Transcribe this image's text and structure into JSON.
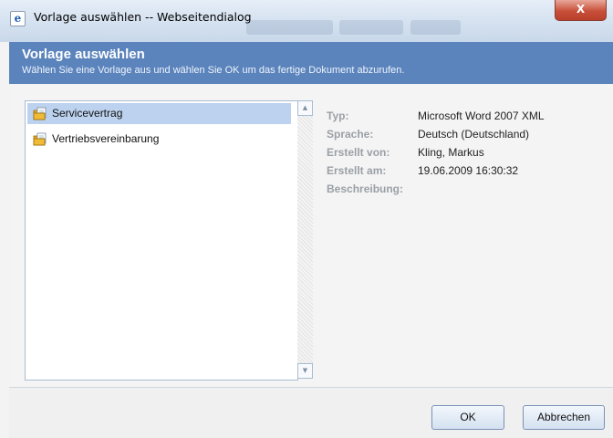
{
  "window": {
    "title": "Vorlage auswählen -- Webseitendialog",
    "close_label": "X"
  },
  "header": {
    "title": "Vorlage auswählen",
    "subtitle": "Wählen Sie eine Vorlage aus und wählen Sie OK um das fertige Dokument abzurufen."
  },
  "templates": {
    "items": [
      {
        "label": "Servicevertrag",
        "selected": true
      },
      {
        "label": "Vertriebsvereinbarung",
        "selected": false
      }
    ]
  },
  "details": {
    "rows": [
      {
        "label": "Typ:",
        "value": "Microsoft Word 2007 XML"
      },
      {
        "label": "Sprache:",
        "value": "Deutsch (Deutschland)"
      },
      {
        "label": "Erstellt von:",
        "value": "Kling, Markus"
      },
      {
        "label": "Erstellt am:",
        "value": "19.06.2009 16:30:32"
      },
      {
        "label": "Beschreibung:",
        "value": ""
      }
    ]
  },
  "footer": {
    "ok_label": "OK",
    "cancel_label": "Abbrechen"
  },
  "colors": {
    "header_bg": "#5b84bd",
    "selection_bg": "#bcd2ef",
    "close_button": "#c8503a"
  },
  "icons": {
    "title": "ie-icon",
    "template_item": "document-folder-icon",
    "scroll_up": "arrow-up-icon",
    "scroll_down": "arrow-down-icon"
  }
}
